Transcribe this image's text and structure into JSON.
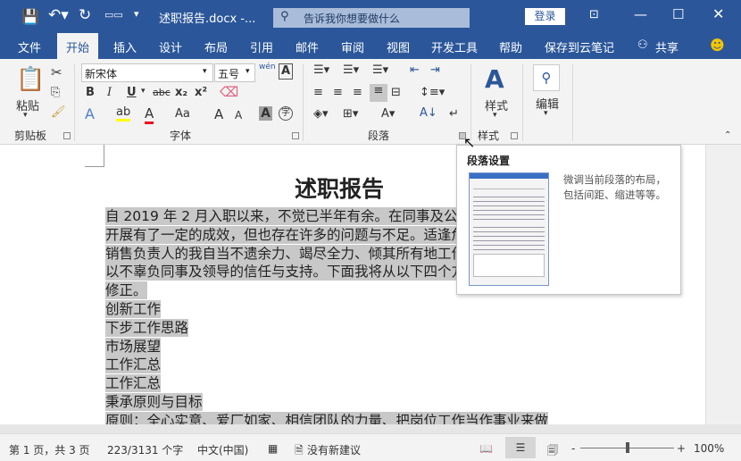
{
  "window": {
    "title": "述职报告.docx -...",
    "search_placeholder": "告诉我你想要做什么",
    "login": "登录"
  },
  "tabs": [
    "文件",
    "开始",
    "插入",
    "设计",
    "布局",
    "引用",
    "邮件",
    "审阅",
    "视图",
    "开发工具",
    "帮助",
    "保存到云笔记"
  ],
  "share": "共享",
  "ribbon": {
    "clipboard": {
      "paste": "粘贴",
      "label": "剪贴板"
    },
    "font": {
      "name": "新宋体",
      "size": "五号",
      "label": "字体",
      "bold": "B",
      "italic": "I",
      "underline": "U",
      "strike": "abc",
      "sub": "x₂",
      "sup": "x²",
      "effects": "A",
      "case": "Aa",
      "grow": "A",
      "shrink": "A",
      "shade": "A",
      "enclose": "字",
      "phonetic": "wén"
    },
    "paragraph": {
      "label": "段落"
    },
    "styles": {
      "button": "样式",
      "label": "样式"
    },
    "editing": {
      "button": "编辑"
    }
  },
  "colors": {
    "brand": "#2b579a",
    "highlight": "#ffff00",
    "font_color": "#e81123",
    "selection": "#c8c8c8"
  },
  "document": {
    "title": "述职报告",
    "lines": [
      "自 2019 年 2 月入职以来，不觉已半年有余。在同事及公司领导的",
      "开展有了一定的成效，但也存在许多的问题与不足。适逢危机下开",
      "销售负责人的我自当不遗余力、竭尽全力、倾其所有地工作态度拼",
      "以不辜负同事及领导的信任与支持。下面我将从以下四个方面来进",
      "修正。",
      "创新工作",
      "下步工作思路",
      "市场展望",
      "工作汇总",
      "工作汇总",
      "秉承原则与目标",
      "原则：全心实意、爱厂如家、相信团队的力量、把岗位工作当作事业来做"
    ]
  },
  "tooltip": {
    "title": "段落设置",
    "description": "微调当前段落的布局，包括间距、缩进等等。"
  },
  "status": {
    "page": "第 1 页，共 3 页",
    "words": "223/3131 个字",
    "language": "中文(中国)",
    "suggestions": "没有新建议",
    "zoom": "100%",
    "zoom_level": 100
  }
}
